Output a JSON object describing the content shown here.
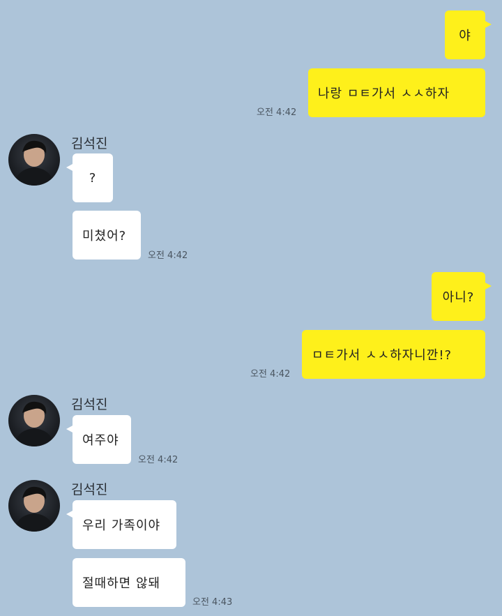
{
  "messages": {
    "m1": "야",
    "m2": "나랑 ㅁㅌ가서 ㅅㅅ하자",
    "m2_time": "오전 4:42",
    "s1_name": "김석진",
    "m3": "?",
    "m4": "미쳤어?",
    "m4_time": "오전 4:42",
    "m5": "아니?",
    "m6": "ㅁㅌ가서 ㅅㅅ하자니깐!?",
    "m6_time": "오전 4:42",
    "s2_name": "김석진",
    "m7": "여주야",
    "m7_time": "오전 4:42",
    "s3_name": "김석진",
    "m8": "우리 가족이야",
    "m9": "절때하면 않돼",
    "m9_time": "오전 4:43"
  },
  "colors": {
    "background": "#adc4d9",
    "my_bubble": "#fef01b",
    "their_bubble": "#ffffff"
  }
}
